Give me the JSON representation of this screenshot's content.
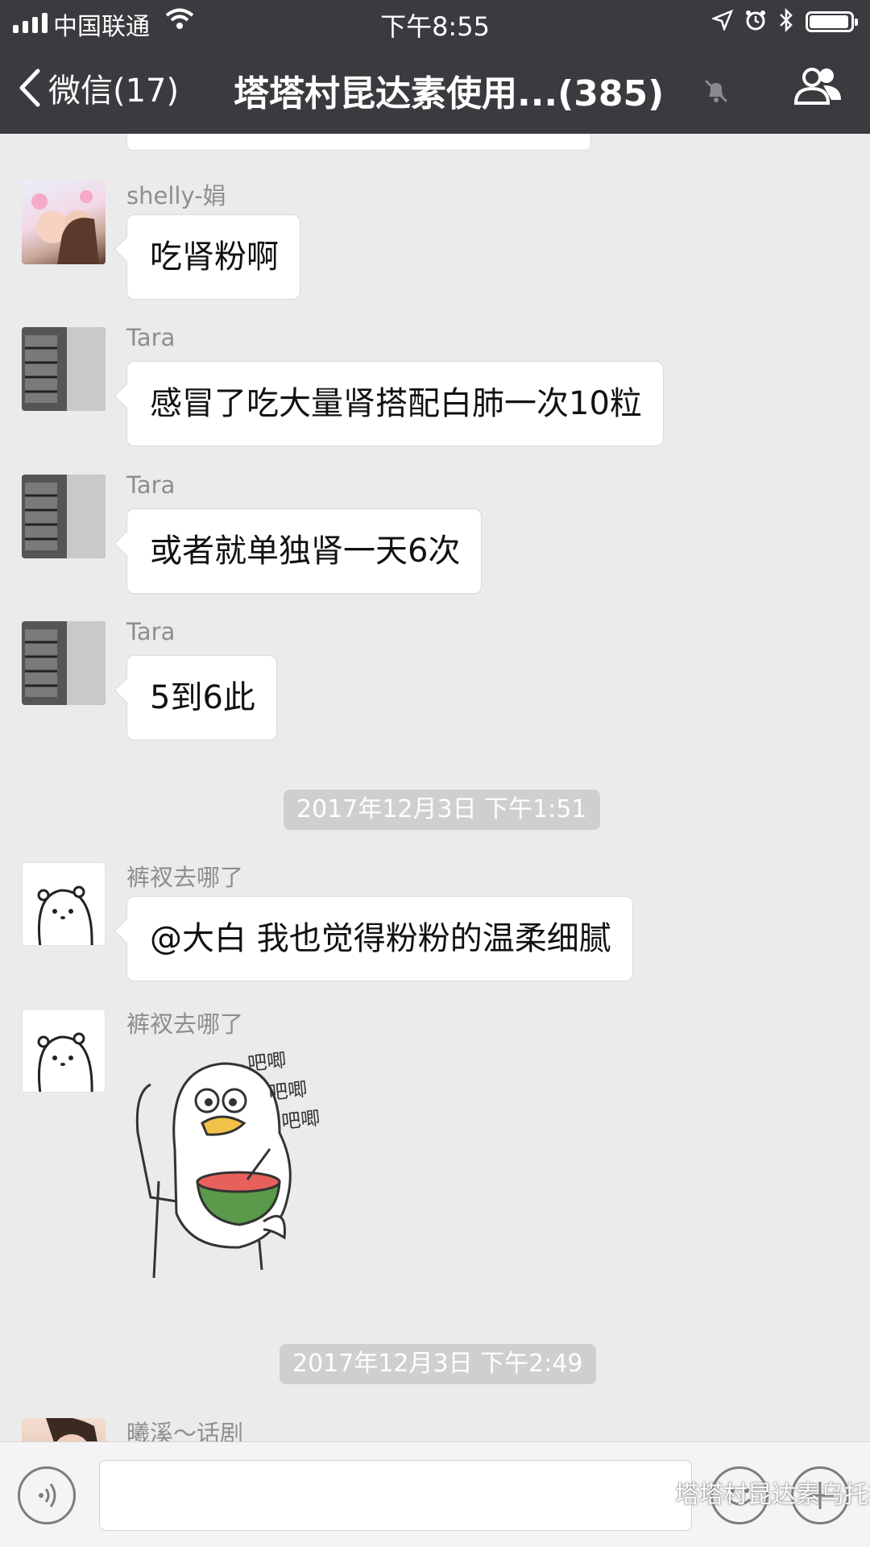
{
  "status_bar": {
    "carrier": "中国联通",
    "time": "下午8:55"
  },
  "nav": {
    "back_label": "微信(17)",
    "title": "塔塔村昆达素使用...(385)"
  },
  "messages": [
    {
      "sender": "shelly-娟",
      "text": "吃肾粉啊"
    },
    {
      "sender": "Tara",
      "text": "感冒了吃大量肾搭配白肺一次10粒"
    },
    {
      "sender": "Tara",
      "text": "或者就单独肾一天6次"
    },
    {
      "sender": "Tara",
      "text": "5到6此"
    },
    {
      "timestamp": "2017年12月3日 下午1:51"
    },
    {
      "sender": "裤衩去哪了",
      "text": "@大白 我也觉得粉粉的温柔细腻"
    },
    {
      "sender": "裤衩去哪了",
      "sticker_text": [
        "吧唧",
        "吧唧",
        "吧唧"
      ]
    },
    {
      "timestamp": "2017年12月3日 下午2:49"
    },
    {
      "sender": "曦溪～话剧"
    }
  ],
  "watermark": "塔塔村昆达素乌托邦",
  "colors": {
    "nav_bg": "#3b3a3f",
    "chat_bg": "#ebebeb",
    "bubble_bg": "#ffffff",
    "timestamp_bg": "#cfcfcf"
  }
}
